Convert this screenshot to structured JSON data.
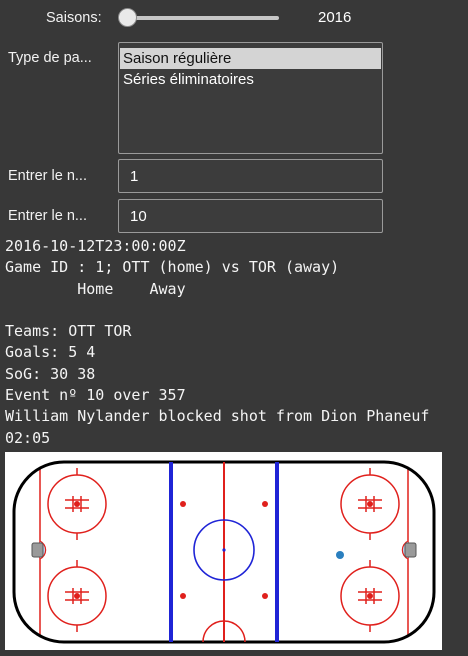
{
  "season": {
    "label": "Saisons:",
    "value": "2016",
    "level": 0
  },
  "game_type": {
    "label": "Type de pa...",
    "options": [
      "Saison régulière",
      "Séries éliminatoires"
    ],
    "selected": "Saison régulière"
  },
  "game_number": {
    "label": "Entrer le n...",
    "value": "1"
  },
  "event_number": {
    "label": "Entrer le n...",
    "value": "10"
  },
  "output": {
    "datetime": "2016-10-12T23:00:00Z",
    "game_line": "Game ID : 1; OTT (home) vs TOR (away)",
    "columns": "        Home    Away",
    "blank": "",
    "teams": "Teams: OTT TOR",
    "goals": "Goals: 5 4",
    "sog": "SoG: 30 38",
    "event": "Event nº 10 over 357",
    "description": "William Nylander blocked shot from Dion Phaneuf",
    "time": "02:05"
  },
  "rink": {
    "colors": {
      "red": "#e0201c",
      "blue": "#1f24d6",
      "event_marker": "#2a7fbf"
    }
  }
}
